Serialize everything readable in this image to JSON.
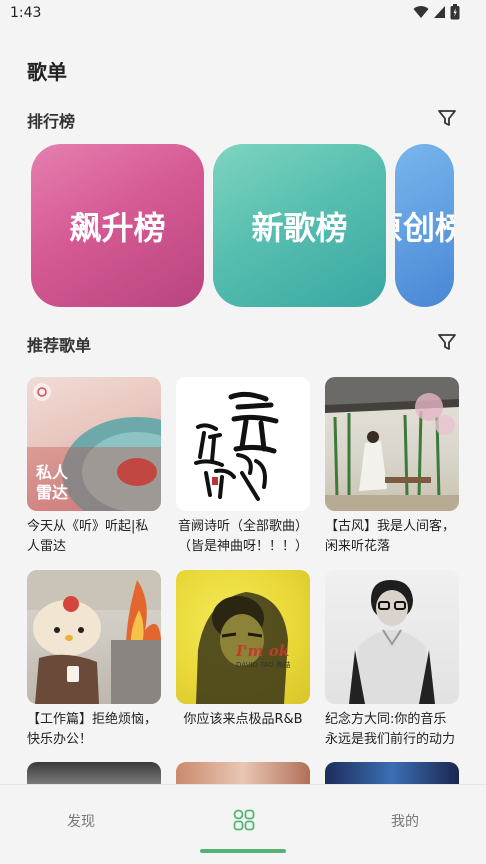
{
  "status_bar": {
    "time": "1:43"
  },
  "page": {
    "title": "歌单"
  },
  "rankings": {
    "label": "排行榜",
    "cards": [
      "飙升榜",
      "新歌榜",
      "原创榜"
    ]
  },
  "recommended": {
    "label": "推荐歌单",
    "playlists": [
      {
        "caption": "今天从《听》听起|私人雷达",
        "cover_text": "私人\n雷达"
      },
      {
        "caption": "音阙诗听（全部歌曲）（皆是神曲呀！！！）",
        "cover_text": "音阙诗听"
      },
      {
        "caption": "【古风】我是人间客，闲来听花落"
      },
      {
        "caption": "【工作篇】拒绝烦恼，快乐办公！"
      },
      {
        "caption": "你应该来点极品R&B",
        "cover_text": "I'm ok",
        "cover_subtext": "DAVID TAO 陶喆"
      },
      {
        "caption": "纪念方大同:你的音乐永远是我们前行的动力"
      }
    ]
  },
  "bottom_nav": {
    "discover": "发现",
    "mine": "我的"
  },
  "colors": {
    "accent": "#54b374"
  }
}
